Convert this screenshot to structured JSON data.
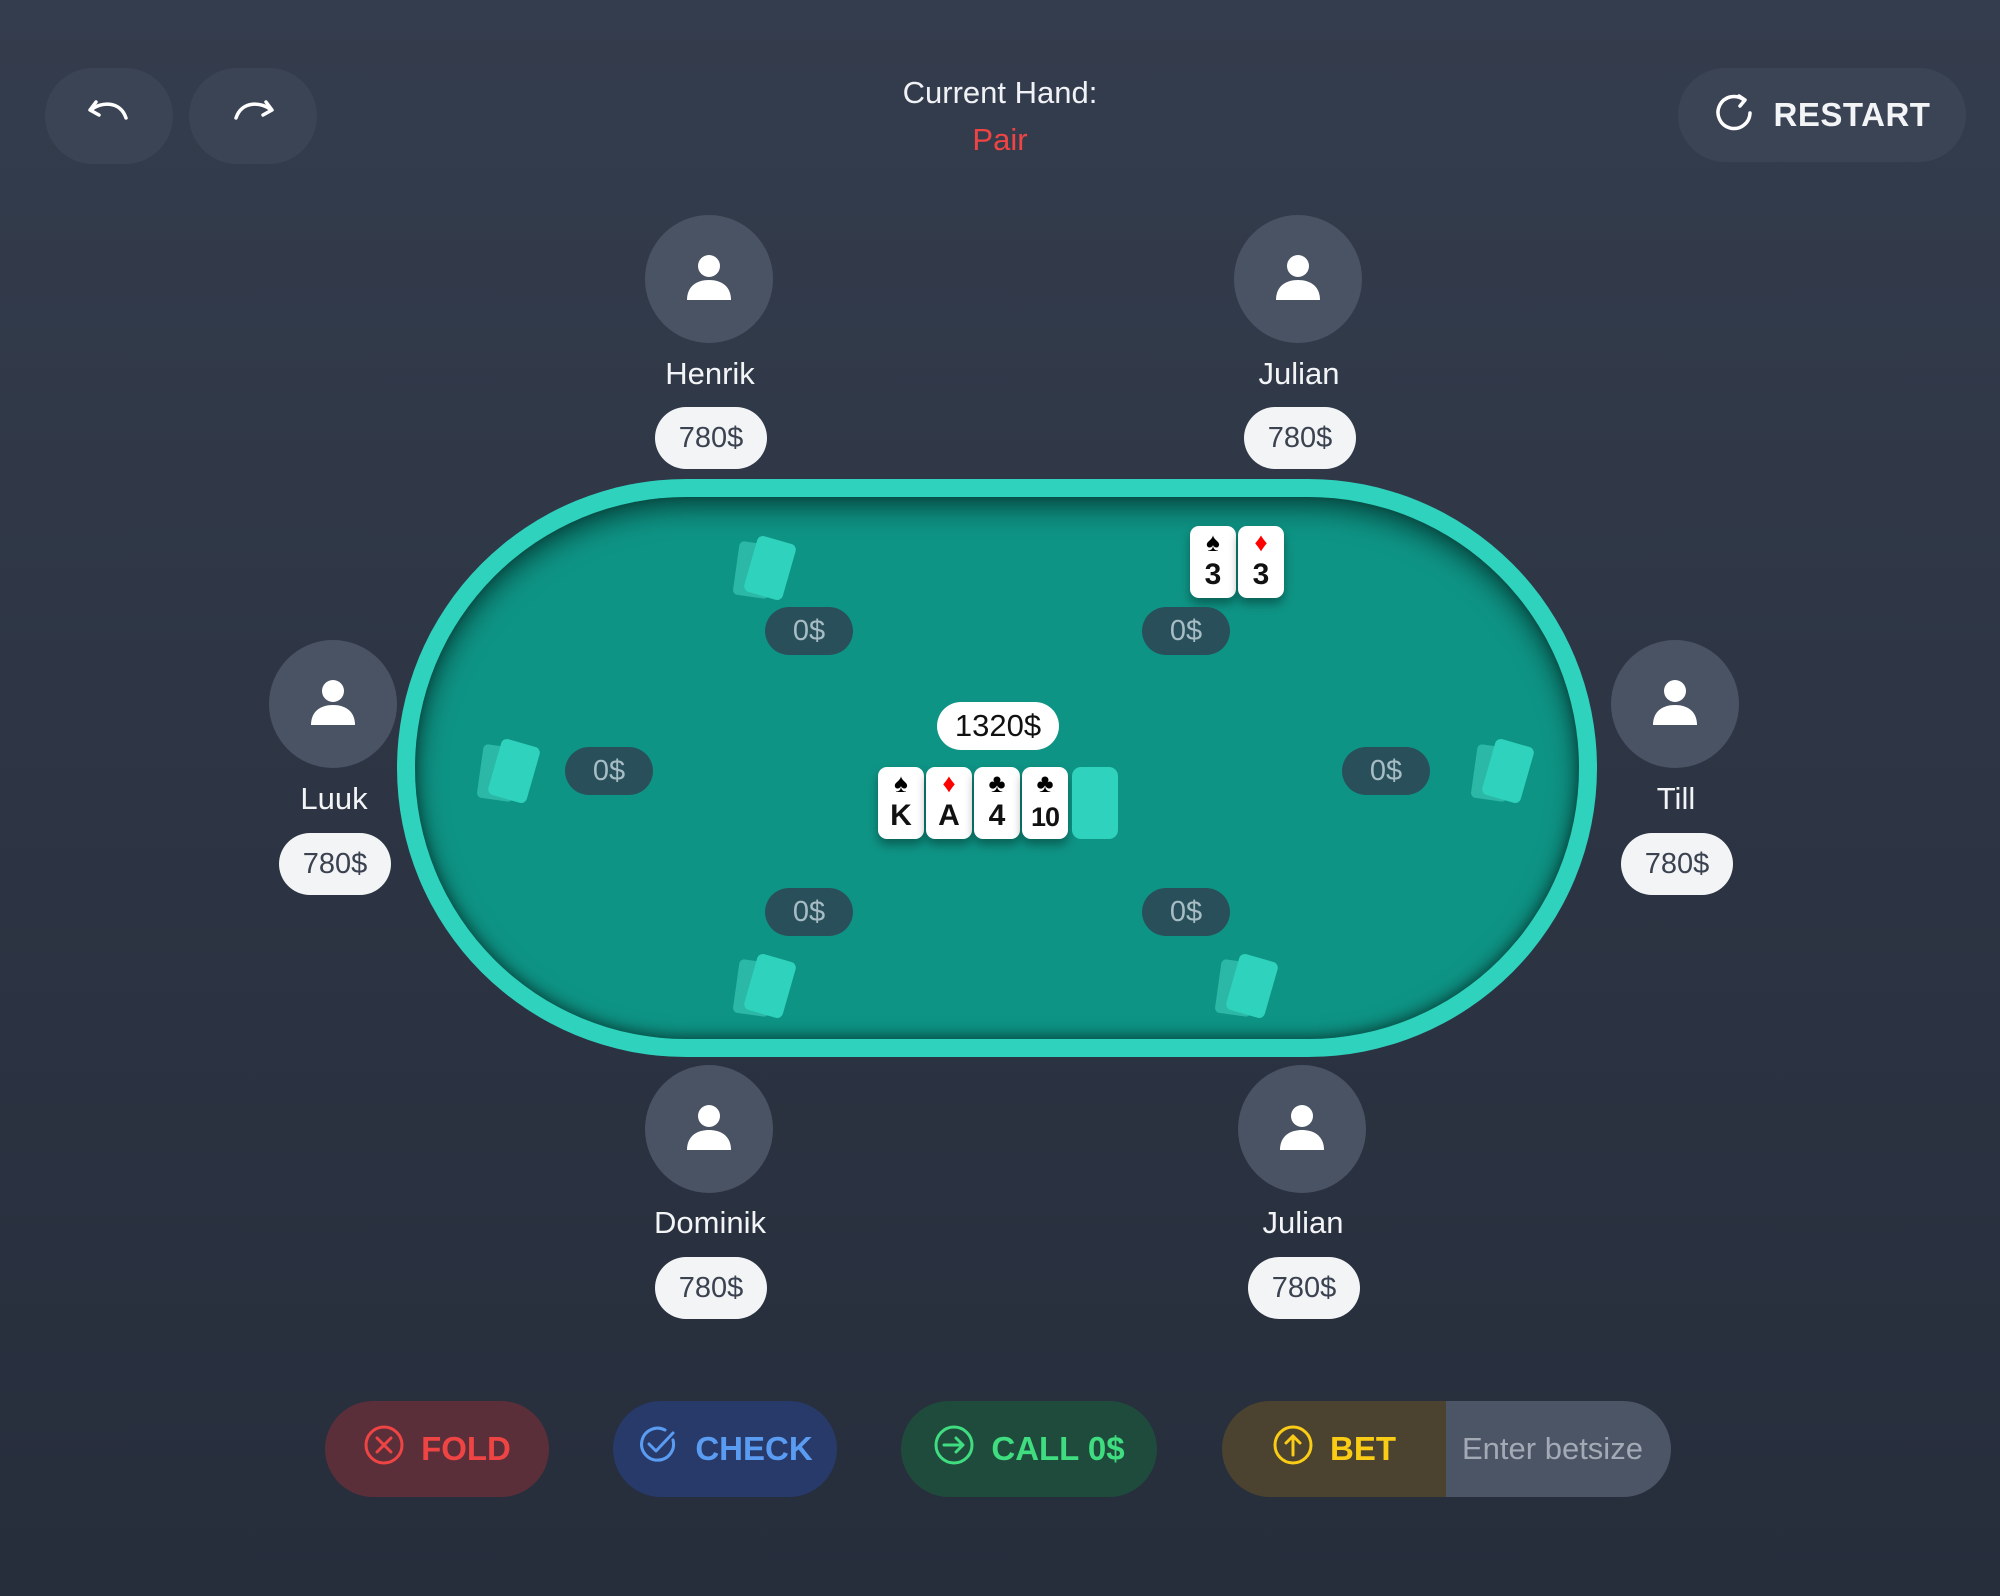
{
  "header": {
    "current_hand_label": "Current Hand:",
    "current_hand_value": "Pair",
    "restart_label": "RESTART",
    "undo_icon": "undo-icon",
    "redo_icon": "redo-icon",
    "restart_icon": "restart-icon"
  },
  "players": [
    {
      "name": "Henrik",
      "stack": "780$",
      "bet": "0$"
    },
    {
      "name": "Julian",
      "stack": "780$",
      "bet": "0$"
    },
    {
      "name": "Luuk",
      "stack": "780$",
      "bet": "0$"
    },
    {
      "name": "Till",
      "stack": "780$",
      "bet": "0$"
    },
    {
      "name": "Dominik",
      "stack": "780$",
      "bet": "0$"
    },
    {
      "name": "Julian",
      "stack": "780$",
      "bet": "0$"
    }
  ],
  "hero_cards": [
    {
      "suit": "♠",
      "rank": "3",
      "color": "black"
    },
    {
      "suit": "♦",
      "rank": "3",
      "color": "red"
    }
  ],
  "pot": "1320$",
  "community_cards": [
    {
      "suit": "♠",
      "rank": "K",
      "color": "black"
    },
    {
      "suit": "♦",
      "rank": "A",
      "color": "red"
    },
    {
      "suit": "♣",
      "rank": "4",
      "color": "black"
    },
    {
      "suit": "♣",
      "rank": "10",
      "color": "black"
    }
  ],
  "actions": {
    "fold_label": "FOLD",
    "check_label": "CHECK",
    "call_label": "CALL 0$",
    "bet_label": "BET",
    "bet_placeholder": "Enter betsize"
  },
  "colors": {
    "background": "#2e3646",
    "table_rim": "#2fd2bd",
    "table_felt": "#0e9485",
    "hand_value": "#ef4444",
    "fold": "#ef4444",
    "check": "#5b9cf3",
    "call": "#3fdc80",
    "bet": "#facc15"
  }
}
